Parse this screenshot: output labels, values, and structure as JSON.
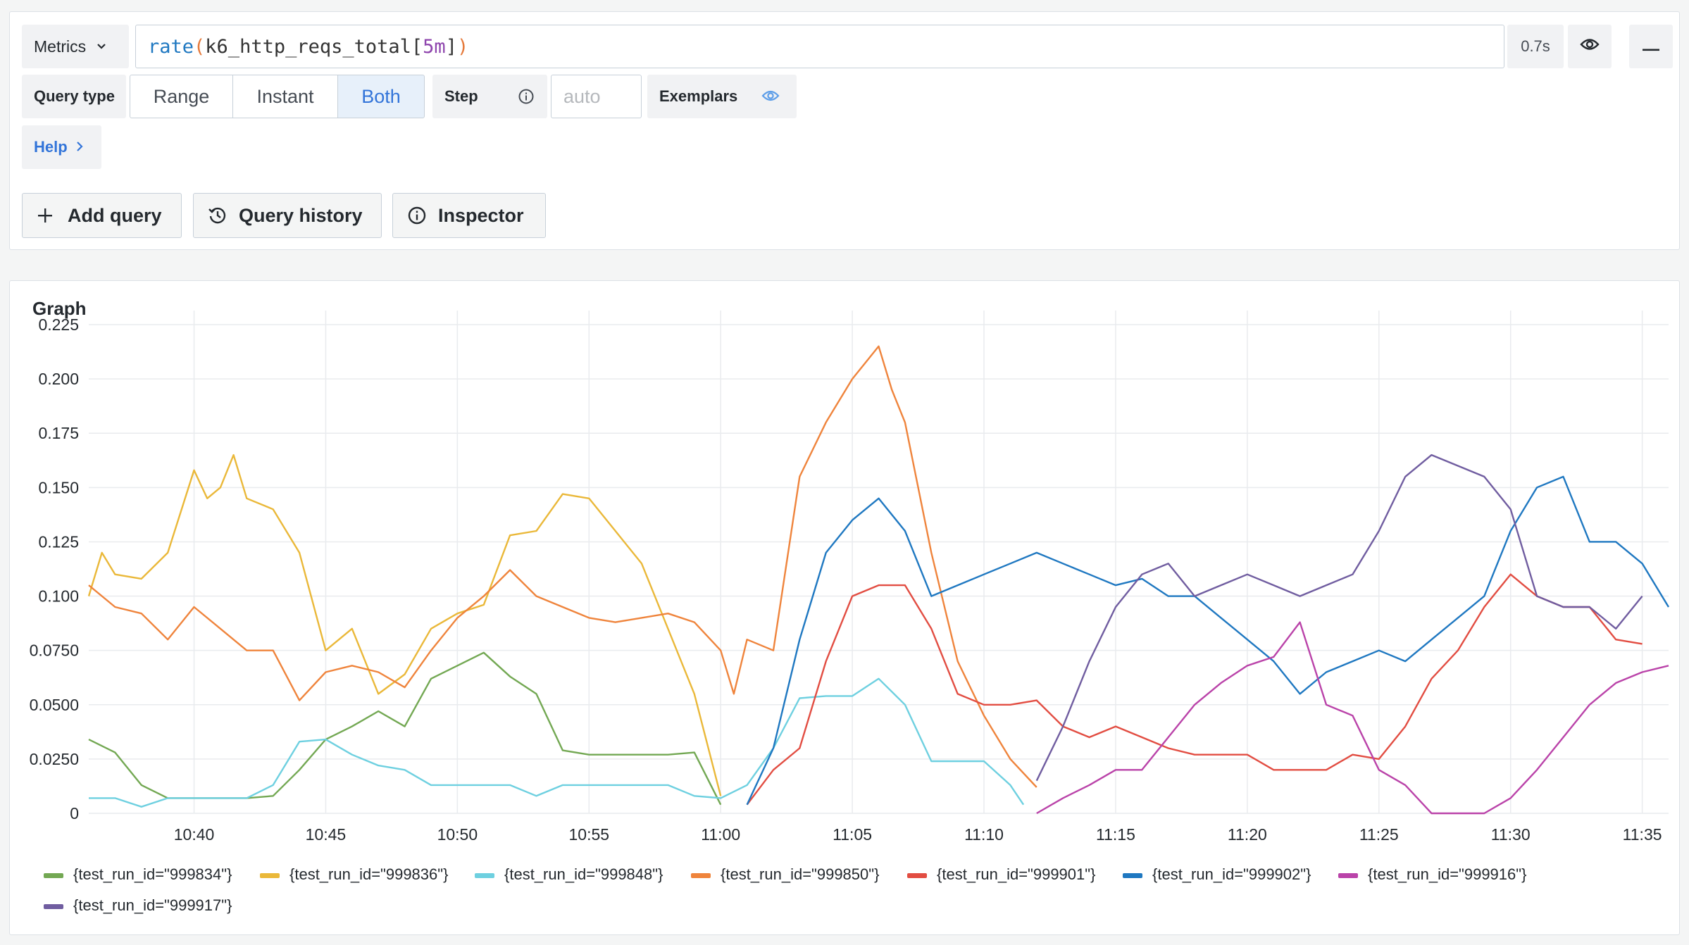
{
  "query": {
    "datasource_label": "Metrics",
    "expr_fn": "rate",
    "expr_open": "(",
    "expr_metric": "k6_http_reqs_total",
    "expr_bracket_open": "[",
    "expr_range": "5m",
    "expr_bracket_close": "]",
    "expr_close": ")",
    "duration": "0.7s",
    "query_type_label": "Query type",
    "query_types": [
      "Range",
      "Instant",
      "Both"
    ],
    "selected_query_type": "Both",
    "step_label": "Step",
    "step_placeholder": "auto",
    "exemplars_label": "Exemplars",
    "help_label": "Help"
  },
  "actions": {
    "add_query": "Add query",
    "query_history": "Query history",
    "inspector": "Inspector"
  },
  "icons": {
    "datasource_chevron": "chevron-down-icon",
    "eye": "eye-icon",
    "minus": "minus-icon",
    "step_info": "info-icon",
    "exemplars_eye": "eye-icon",
    "help_chevron": "chevron-right-icon",
    "add": "plus-icon",
    "history": "history-icon",
    "inspector": "info-icon"
  },
  "graph": {
    "title": "Graph"
  },
  "chart_data": {
    "type": "line",
    "title": "",
    "xlabel": "",
    "ylabel": "",
    "ylim": [
      0,
      0.225
    ],
    "xlim": [
      "10:36",
      "11:36"
    ],
    "y_ticks": [
      "0",
      "0.0250",
      "0.0500",
      "0.0750",
      "0.100",
      "0.125",
      "0.150",
      "0.175",
      "0.200",
      "0.225"
    ],
    "x_ticks": [
      "10:40",
      "10:45",
      "10:50",
      "10:55",
      "11:00",
      "11:05",
      "11:10",
      "11:15",
      "11:20",
      "11:25",
      "11:30",
      "11:35"
    ],
    "grid": true,
    "legend_position": "bottom",
    "series": [
      {
        "name": "{test_run_id=\"999834\"}",
        "color": "#73a853",
        "points": [
          [
            "10:36",
            0.034
          ],
          [
            "10:37",
            0.028
          ],
          [
            "10:38",
            0.013
          ],
          [
            "10:39",
            0.007
          ],
          [
            "10:40",
            0.007
          ],
          [
            "10:41",
            0.007
          ],
          [
            "10:42",
            0.007
          ],
          [
            "10:43",
            0.008
          ],
          [
            "10:44",
            0.02
          ],
          [
            "10:45",
            0.034
          ],
          [
            "10:46",
            0.04
          ],
          [
            "10:47",
            0.047
          ],
          [
            "10:48",
            0.04
          ],
          [
            "10:49",
            0.062
          ],
          [
            "10:50",
            0.068
          ],
          [
            "10:51",
            0.074
          ],
          [
            "10:52",
            0.063
          ],
          [
            "10:53",
            0.055
          ],
          [
            "10:54",
            0.029
          ],
          [
            "10:55",
            0.027
          ],
          [
            "10:56",
            0.027
          ],
          [
            "10:57",
            0.027
          ],
          [
            "10:58",
            0.027
          ],
          [
            "10:59",
            0.028
          ],
          [
            "11:00",
            0.004
          ]
        ]
      },
      {
        "name": "{test_run_id=\"999836\"}",
        "color": "#eab839",
        "points": [
          [
            "10:36",
            0.1
          ],
          [
            "10:36.5",
            0.12
          ],
          [
            "10:37",
            0.11
          ],
          [
            "10:38",
            0.108
          ],
          [
            "10:39",
            0.12
          ],
          [
            "10:40",
            0.158
          ],
          [
            "10:40.5",
            0.145
          ],
          [
            "10:41",
            0.15
          ],
          [
            "10:41.5",
            0.165
          ],
          [
            "10:42",
            0.145
          ],
          [
            "10:43",
            0.14
          ],
          [
            "10:44",
            0.12
          ],
          [
            "10:45",
            0.075
          ],
          [
            "10:46",
            0.085
          ],
          [
            "10:47",
            0.055
          ],
          [
            "10:48",
            0.064
          ],
          [
            "10:49",
            0.085
          ],
          [
            "10:50",
            0.092
          ],
          [
            "10:51",
            0.096
          ],
          [
            "10:52",
            0.128
          ],
          [
            "10:53",
            0.13
          ],
          [
            "10:54",
            0.147
          ],
          [
            "10:55",
            0.145
          ],
          [
            "10:56",
            0.13
          ],
          [
            "10:57",
            0.115
          ],
          [
            "10:58",
            0.085
          ],
          [
            "10:59",
            0.055
          ],
          [
            "11:00",
            0.008
          ]
        ]
      },
      {
        "name": "{test_run_id=\"999848\"}",
        "color": "#6ed0e0",
        "points": [
          [
            "10:36",
            0.007
          ],
          [
            "10:37",
            0.007
          ],
          [
            "10:38",
            0.003
          ],
          [
            "10:39",
            0.007
          ],
          [
            "10:40",
            0.007
          ],
          [
            "10:41",
            0.007
          ],
          [
            "10:42",
            0.007
          ],
          [
            "10:43",
            0.013
          ],
          [
            "10:44",
            0.033
          ],
          [
            "10:45",
            0.034
          ],
          [
            "10:46",
            0.027
          ],
          [
            "10:47",
            0.022
          ],
          [
            "10:48",
            0.02
          ],
          [
            "10:49",
            0.013
          ],
          [
            "10:50",
            0.013
          ],
          [
            "10:51",
            0.013
          ],
          [
            "10:52",
            0.013
          ],
          [
            "10:53",
            0.008
          ],
          [
            "10:54",
            0.013
          ],
          [
            "10:55",
            0.013
          ],
          [
            "10:56",
            0.013
          ],
          [
            "10:57",
            0.013
          ],
          [
            "10:58",
            0.013
          ],
          [
            "10:59",
            0.008
          ],
          [
            "11:00",
            0.007
          ],
          [
            "11:01",
            0.013
          ],
          [
            "11:02",
            0.03
          ],
          [
            "11:03",
            0.053
          ],
          [
            "11:04",
            0.054
          ],
          [
            "11:05",
            0.054
          ],
          [
            "11:06",
            0.062
          ],
          [
            "11:07",
            0.05
          ],
          [
            "11:08",
            0.024
          ],
          [
            "11:09",
            0.024
          ],
          [
            "11:10",
            0.024
          ],
          [
            "11:11",
            0.013
          ],
          [
            "11:11.5",
            0.004
          ]
        ]
      },
      {
        "name": "{test_run_id=\"999850\"}",
        "color": "#ef843c",
        "points": [
          [
            "10:36",
            0.105
          ],
          [
            "10:37",
            0.095
          ],
          [
            "10:38",
            0.092
          ],
          [
            "10:39",
            0.08
          ],
          [
            "10:40",
            0.095
          ],
          [
            "10:41",
            0.085
          ],
          [
            "10:42",
            0.075
          ],
          [
            "10:43",
            0.075
          ],
          [
            "10:44",
            0.052
          ],
          [
            "10:45",
            0.065
          ],
          [
            "10:46",
            0.068
          ],
          [
            "10:47",
            0.065
          ],
          [
            "10:48",
            0.058
          ],
          [
            "10:49",
            0.075
          ],
          [
            "10:50",
            0.09
          ],
          [
            "10:51",
            0.1
          ],
          [
            "10:52",
            0.112
          ],
          [
            "10:53",
            0.1
          ],
          [
            "10:54",
            0.095
          ],
          [
            "10:55",
            0.09
          ],
          [
            "10:56",
            0.088
          ],
          [
            "10:57",
            0.09
          ],
          [
            "10:58",
            0.092
          ],
          [
            "10:59",
            0.088
          ],
          [
            "11:00",
            0.075
          ],
          [
            "11:00.5",
            0.055
          ],
          [
            "11:01",
            0.08
          ],
          [
            "11:02",
            0.075
          ],
          [
            "11:03",
            0.155
          ],
          [
            "11:04",
            0.18
          ],
          [
            "11:05",
            0.2
          ],
          [
            "11:06",
            0.215
          ],
          [
            "11:06.5",
            0.195
          ],
          [
            "11:07",
            0.18
          ],
          [
            "11:08",
            0.12
          ],
          [
            "11:09",
            0.07
          ],
          [
            "11:10",
            0.045
          ],
          [
            "11:11",
            0.025
          ],
          [
            "11:12",
            0.012
          ]
        ]
      },
      {
        "name": "{test_run_id=\"999901\"}",
        "color": "#e24d42",
        "points": [
          [
            "11:01",
            0.004
          ],
          [
            "11:02",
            0.02
          ],
          [
            "11:03",
            0.03
          ],
          [
            "11:04",
            0.07
          ],
          [
            "11:05",
            0.1
          ],
          [
            "11:06",
            0.105
          ],
          [
            "11:07",
            0.105
          ],
          [
            "11:08",
            0.085
          ],
          [
            "11:09",
            0.055
          ],
          [
            "11:10",
            0.05
          ],
          [
            "11:11",
            0.05
          ],
          [
            "11:12",
            0.052
          ],
          [
            "11:13",
            0.04
          ],
          [
            "11:14",
            0.035
          ],
          [
            "11:15",
            0.04
          ],
          [
            "11:16",
            0.035
          ],
          [
            "11:17",
            0.03
          ],
          [
            "11:18",
            0.027
          ],
          [
            "11:19",
            0.027
          ],
          [
            "11:20",
            0.027
          ],
          [
            "11:21",
            0.02
          ],
          [
            "11:22",
            0.02
          ],
          [
            "11:23",
            0.02
          ],
          [
            "11:24",
            0.027
          ],
          [
            "11:25",
            0.025
          ],
          [
            "11:26",
            0.04
          ],
          [
            "11:27",
            0.062
          ],
          [
            "11:28",
            0.075
          ],
          [
            "11:29",
            0.095
          ],
          [
            "11:30",
            0.11
          ],
          [
            "11:31",
            0.1
          ],
          [
            "11:32",
            0.095
          ],
          [
            "11:33",
            0.095
          ],
          [
            "11:34",
            0.08
          ],
          [
            "11:35",
            0.078
          ]
        ]
      },
      {
        "name": "{test_run_id=\"999902\"}",
        "color": "#1f78c1",
        "points": [
          [
            "11:01",
            0.004
          ],
          [
            "11:02",
            0.03
          ],
          [
            "11:03",
            0.08
          ],
          [
            "11:04",
            0.12
          ],
          [
            "11:05",
            0.135
          ],
          [
            "11:06",
            0.145
          ],
          [
            "11:07",
            0.13
          ],
          [
            "11:08",
            0.1
          ],
          [
            "11:09",
            0.105
          ],
          [
            "11:10",
            0.11
          ],
          [
            "11:11",
            0.115
          ],
          [
            "11:12",
            0.12
          ],
          [
            "11:13",
            0.115
          ],
          [
            "11:14",
            0.11
          ],
          [
            "11:15",
            0.105
          ],
          [
            "11:16",
            0.108
          ],
          [
            "11:17",
            0.1
          ],
          [
            "11:18",
            0.1
          ],
          [
            "11:19",
            0.09
          ],
          [
            "11:20",
            0.08
          ],
          [
            "11:21",
            0.07
          ],
          [
            "11:22",
            0.055
          ],
          [
            "11:23",
            0.065
          ],
          [
            "11:24",
            0.07
          ],
          [
            "11:25",
            0.075
          ],
          [
            "11:26",
            0.07
          ],
          [
            "11:27",
            0.08
          ],
          [
            "11:28",
            0.09
          ],
          [
            "11:29",
            0.1
          ],
          [
            "11:30",
            0.13
          ],
          [
            "11:31",
            0.15
          ],
          [
            "11:32",
            0.155
          ],
          [
            "11:33",
            0.125
          ],
          [
            "11:34",
            0.125
          ],
          [
            "11:35",
            0.115
          ],
          [
            "11:36",
            0.095
          ]
        ]
      },
      {
        "name": "{test_run_id=\"999916\"}",
        "color": "#ba43a9",
        "points": [
          [
            "11:12",
            0.0
          ],
          [
            "11:13",
            0.007
          ],
          [
            "11:14",
            0.013
          ],
          [
            "11:15",
            0.02
          ],
          [
            "11:16",
            0.02
          ],
          [
            "11:17",
            0.035
          ],
          [
            "11:18",
            0.05
          ],
          [
            "11:19",
            0.06
          ],
          [
            "11:20",
            0.068
          ],
          [
            "11:21",
            0.072
          ],
          [
            "11:22",
            0.088
          ],
          [
            "11:23",
            0.05
          ],
          [
            "11:24",
            0.045
          ],
          [
            "11:25",
            0.02
          ],
          [
            "11:26",
            0.013
          ],
          [
            "11:27",
            0.0
          ],
          [
            "11:28",
            0.0
          ],
          [
            "11:29",
            0.0
          ],
          [
            "11:30",
            0.007
          ],
          [
            "11:31",
            0.02
          ],
          [
            "11:32",
            0.035
          ],
          [
            "11:33",
            0.05
          ],
          [
            "11:34",
            0.06
          ],
          [
            "11:35",
            0.065
          ],
          [
            "11:36",
            0.068
          ]
        ]
      },
      {
        "name": "{test_run_id=\"999917\"}",
        "color": "#705da0",
        "points": [
          [
            "11:12",
            0.015
          ],
          [
            "11:13",
            0.04
          ],
          [
            "11:14",
            0.07
          ],
          [
            "11:15",
            0.095
          ],
          [
            "11:16",
            0.11
          ],
          [
            "11:17",
            0.115
          ],
          [
            "11:18",
            0.1
          ],
          [
            "11:19",
            0.105
          ],
          [
            "11:20",
            0.11
          ],
          [
            "11:21",
            0.105
          ],
          [
            "11:22",
            0.1
          ],
          [
            "11:23",
            0.105
          ],
          [
            "11:24",
            0.11
          ],
          [
            "11:25",
            0.13
          ],
          [
            "11:26",
            0.155
          ],
          [
            "11:27",
            0.165
          ],
          [
            "11:28",
            0.16
          ],
          [
            "11:29",
            0.155
          ],
          [
            "11:30",
            0.14
          ],
          [
            "11:31",
            0.1
          ],
          [
            "11:32",
            0.095
          ],
          [
            "11:33",
            0.095
          ],
          [
            "11:34",
            0.085
          ],
          [
            "11:35",
            0.1
          ]
        ]
      }
    ]
  }
}
